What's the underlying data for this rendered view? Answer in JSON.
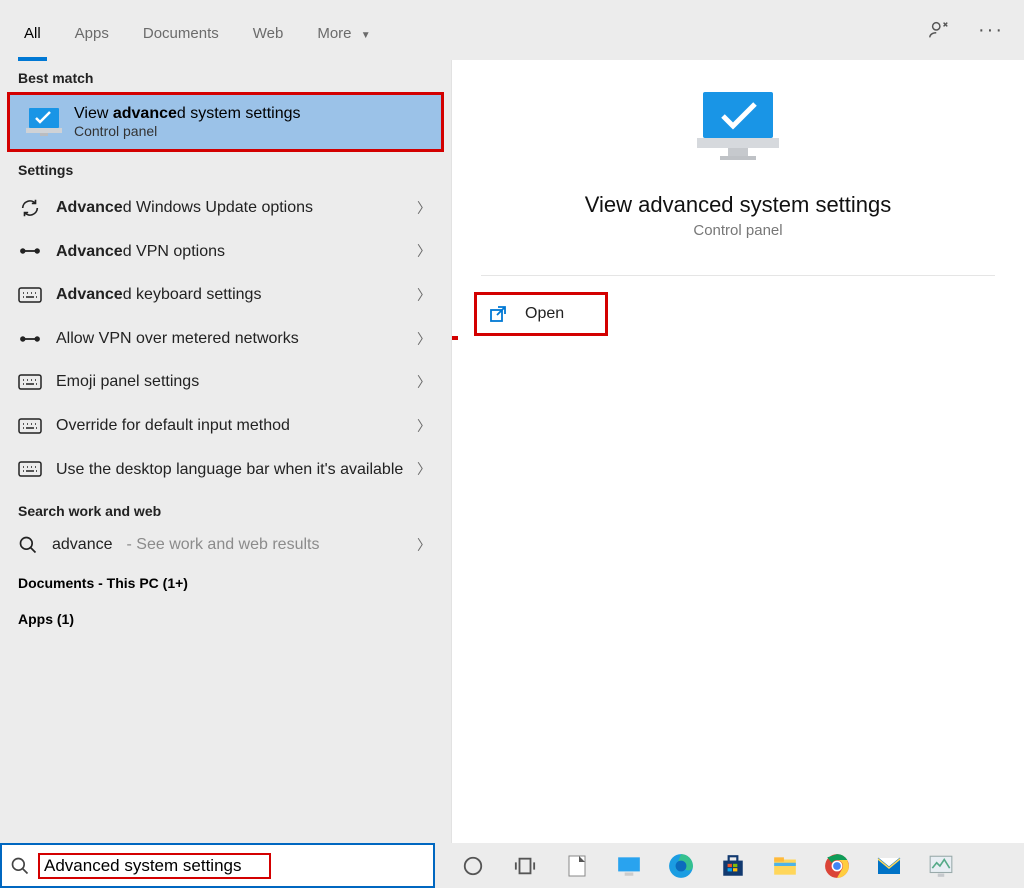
{
  "topbar": {
    "tabs": [
      "All",
      "Apps",
      "Documents",
      "Web",
      "More"
    ],
    "active": 0
  },
  "left": {
    "best_match_label": "Best match",
    "best_match": {
      "title_pre": "View ",
      "title_bold": "advance",
      "title_post": "d system settings",
      "subtitle": "Control panel"
    },
    "settings_label": "Settings",
    "items": [
      {
        "icon": "refresh",
        "pre": "",
        "bold": "Advance",
        "post": "d Windows Update options"
      },
      {
        "icon": "vpn",
        "pre": "",
        "bold": "Advance",
        "post": "d VPN options"
      },
      {
        "icon": "keyboard",
        "pre": "",
        "bold": "Advance",
        "post": "d keyboard settings"
      },
      {
        "icon": "vpn",
        "pre": "Allow VPN over metered networks",
        "bold": "",
        "post": ""
      },
      {
        "icon": "keyboard",
        "pre": "Emoji panel settings",
        "bold": "",
        "post": ""
      },
      {
        "icon": "keyboard",
        "pre": "Override for default input method",
        "bold": "",
        "post": ""
      },
      {
        "icon": "keyboard",
        "pre": "Use the desktop language bar when it's available",
        "bold": "",
        "post": ""
      }
    ],
    "web_label": "Search work and web",
    "web": {
      "term": "advance",
      "suffix": " - See work and web results"
    },
    "docs_label": "Documents - This PC (1+)",
    "apps_label": "Apps (1)"
  },
  "right": {
    "title": "View advanced system settings",
    "subtitle": "Control panel",
    "action": "Open"
  },
  "searchbox": {
    "value": "Advanced system settings"
  }
}
